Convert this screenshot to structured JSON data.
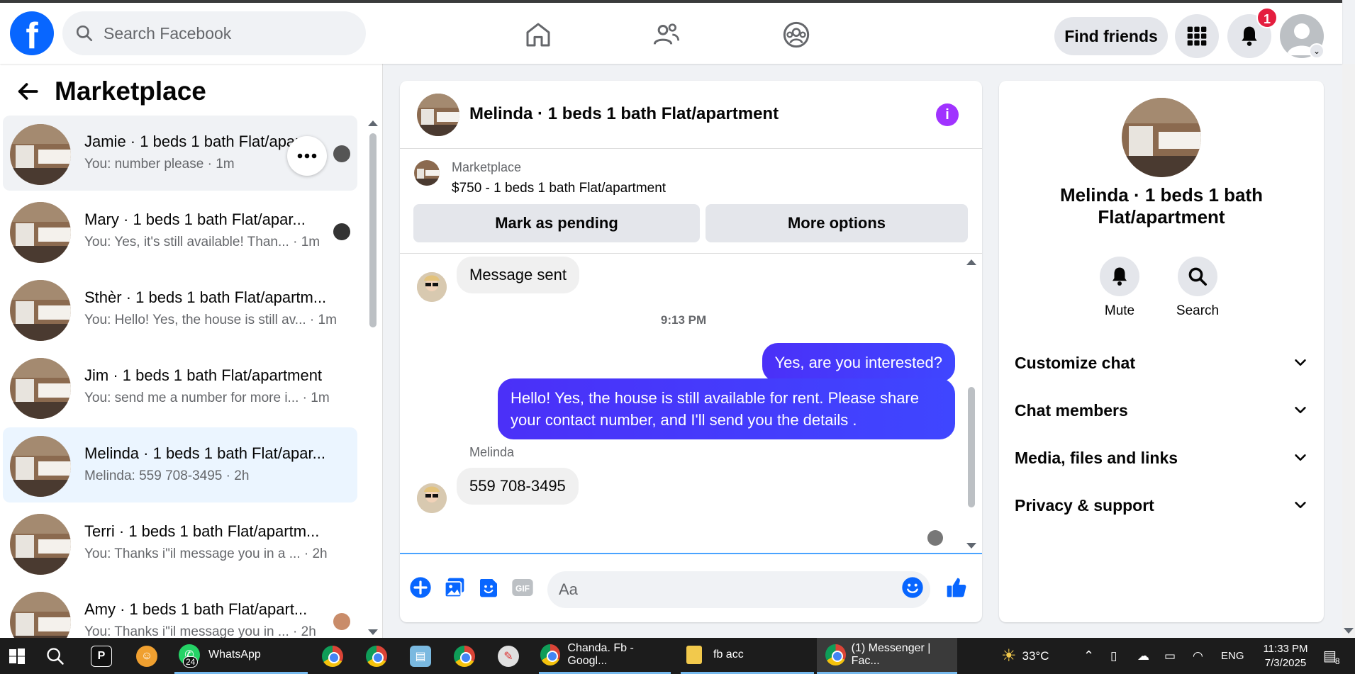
{
  "topbar": {
    "search_placeholder": "Search Facebook",
    "find_friends": "Find friends",
    "notification_count": "1",
    "logo_letter": "f"
  },
  "marketplace": {
    "title": "Marketplace",
    "conversations": [
      {
        "name": "Jamie · 1 beds 1 bath Flat/apar...",
        "snippet": "You: number please · 1m"
      },
      {
        "name": "Mary · 1 beds 1 bath Flat/apar...",
        "snippet": "You: Yes, it's still available! Than... · 1m"
      },
      {
        "name": "Sthèr · 1 beds 1 bath Flat/apartm...",
        "snippet": "You: Hello! Yes, the house is still av... · 1m"
      },
      {
        "name": "Jim · 1 beds 1 bath Flat/apartment",
        "snippet": "You: send me a number for more i... · 1m"
      },
      {
        "name": "Melinda · 1 beds 1 bath Flat/apar...",
        "snippet": "Melinda: 559 708-3495 · 2h"
      },
      {
        "name": "Terri · 1 beds 1 bath Flat/apartm...",
        "snippet": "You: Thanks i\"il message you in a ...  · 2h"
      },
      {
        "name": "Amy · 1 beds 1 bath Flat/apart...",
        "snippet": "You: Thanks i\"il message you in ... · 2h"
      }
    ]
  },
  "chat": {
    "title": "Melinda · 1 beds 1 bath Flat/apartment",
    "listing_label": "Marketplace",
    "listing_price": "$750 - 1 beds 1 bath Flat/apartment",
    "mark_pending": "Mark as pending",
    "more_options": "More options",
    "messages": {
      "sent_notice": "Message sent",
      "time": "9:13 PM",
      "out1": "Yes, are you interested?",
      "out2": "Hello! Yes, the house is still available for rent. Please share your contact number, and I'll send you the details .",
      "sender": "Melinda",
      "in1": "559 708-3495"
    },
    "input_placeholder": "Aa",
    "gif_label": "GIF"
  },
  "details": {
    "name": "Melinda · 1 beds 1 bath Flat/apartment",
    "mute": "Mute",
    "search": "Search",
    "sections": [
      "Customize chat",
      "Chat members",
      "Media, files and links",
      "Privacy & support"
    ]
  },
  "taskbar": {
    "whatsapp": "WhatsApp",
    "whatsapp_badge": "24",
    "chrome_tab1": "Chanda. Fb - Googl...",
    "folder": "fb acc",
    "chrome_tab2": "(1) Messenger | Fac...",
    "weather": "33°C",
    "lang": "ENG",
    "time": "11:33 PM",
    "date": "7/3/2025",
    "notif_count": "8"
  },
  "colors": {
    "brand": "#0866ff",
    "outgoing_bubble": "#4b30f8",
    "active_row": "#ebf5ff",
    "info_icon": "#a033ff"
  }
}
